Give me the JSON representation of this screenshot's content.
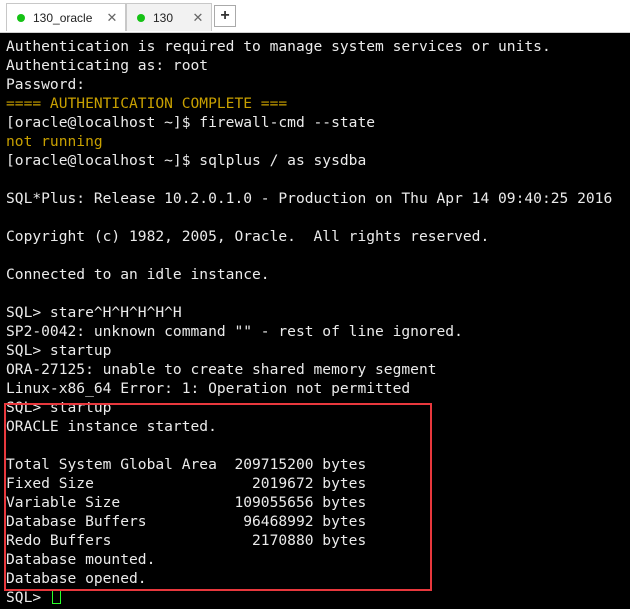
{
  "tabs": [
    {
      "label": "130_oracle",
      "status_color": "#15c215"
    },
    {
      "label": "130",
      "status_color": "#15c215"
    }
  ],
  "new_tab_label": "+",
  "close_glyph": "✕",
  "terminal": {
    "lines": [
      "Authentication is required to manage system services or units.",
      "Authenticating as: root",
      "Password:",
      "==== AUTHENTICATION COMPLETE ===",
      "[oracle@localhost ~]$ firewall-cmd --state",
      "not running",
      "[oracle@localhost ~]$ sqlplus / as sysdba",
      "",
      "SQL*Plus: Release 10.2.0.1.0 - Production on Thu Apr 14 09:40:25 2016",
      "",
      "Copyright (c) 1982, 2005, Oracle.  All rights reserved.",
      "",
      "Connected to an idle instance.",
      "",
      "SQL> stare^H^H^H^H^H",
      "SP2-0042: unknown command \"\" - rest of line ignored.",
      "SQL> startup",
      "ORA-27125: unable to create shared memory segment",
      "Linux-x86_64 Error: 1: Operation not permitted",
      "SQL> startup",
      "ORACLE instance started.",
      "",
      "Total System Global Area  209715200 bytes",
      "Fixed Size                  2019672 bytes",
      "Variable Size             109055656 bytes",
      "Database Buffers           96468992 bytes",
      "Redo Buffers                2170880 bytes",
      "Database mounted.",
      "Database opened.",
      "SQL> "
    ],
    "yellow_line_indices": [
      3,
      5
    ],
    "text_color": "#ebebeb",
    "warning_color": "#c8a000",
    "cursor_color": "#2aff2a",
    "highlight_color": "#e8383d"
  }
}
